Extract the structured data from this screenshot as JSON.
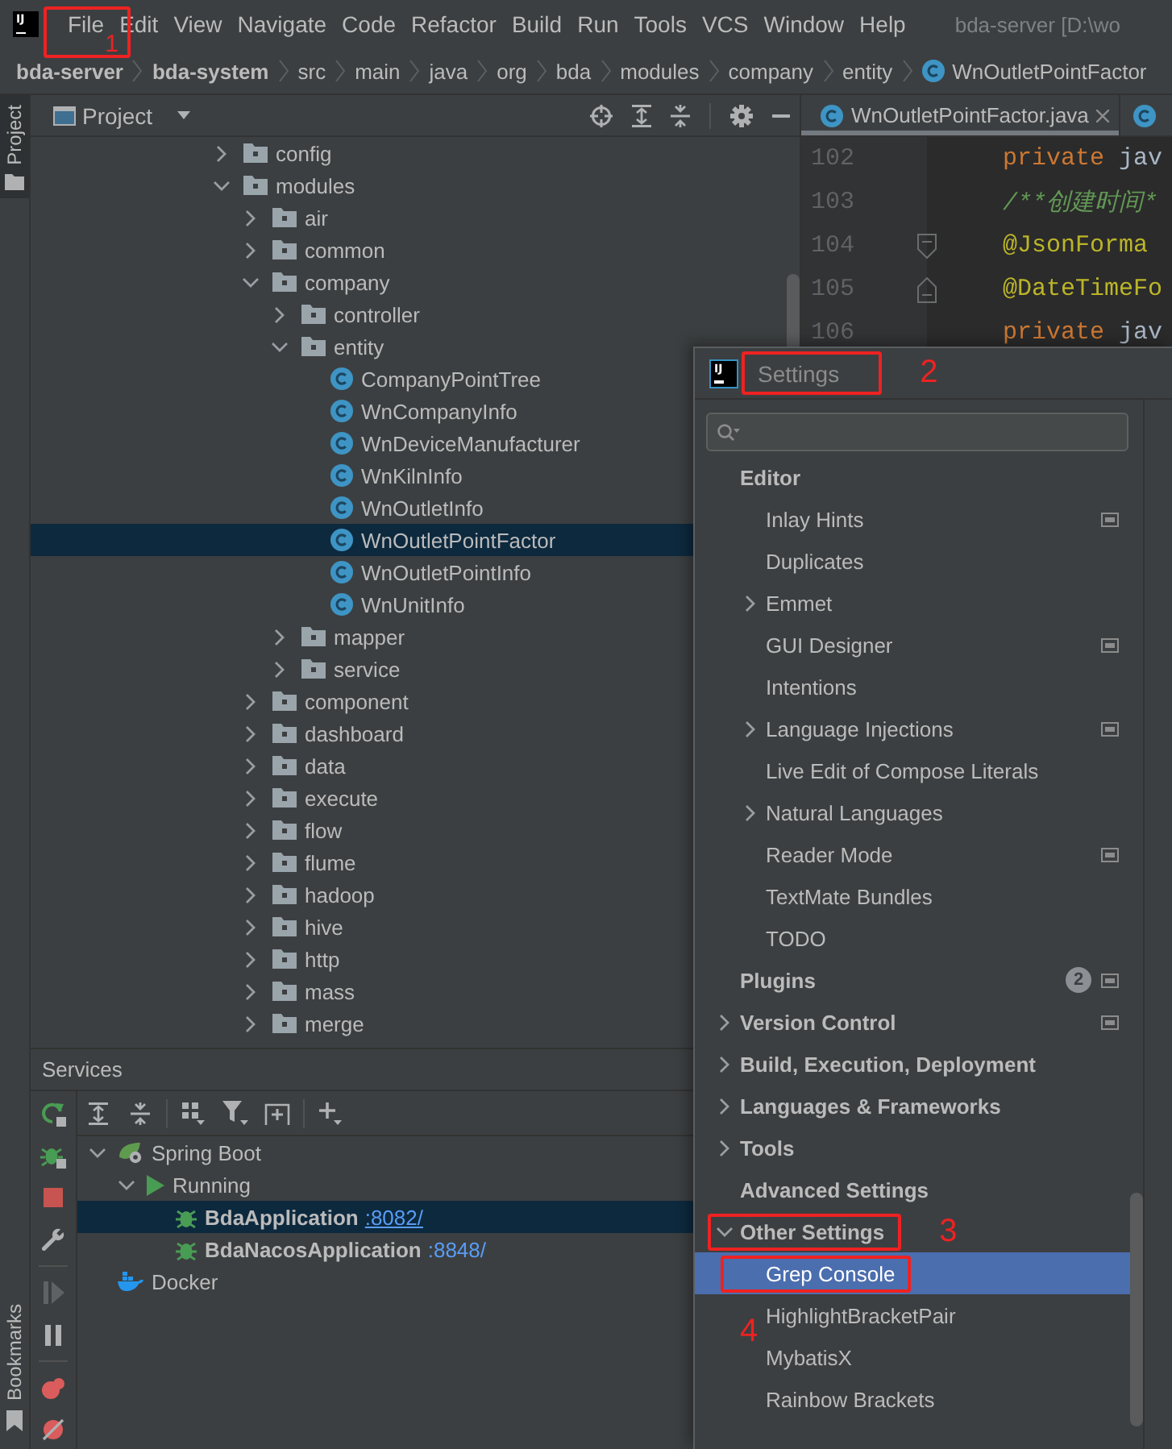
{
  "menu_bar": {
    "logo": "IJ",
    "items": [
      {
        "label": "File",
        "annotation": {
          "number": "1",
          "kind": "inside"
        }
      },
      {
        "label": "Edit"
      },
      {
        "label": "View"
      },
      {
        "label": "Navigate"
      },
      {
        "label": "Code"
      },
      {
        "label": "Refactor"
      },
      {
        "label": "Build"
      },
      {
        "label": "Run"
      },
      {
        "label": "Tools"
      },
      {
        "label": "VCS"
      },
      {
        "label": "Window"
      },
      {
        "label": "Help"
      }
    ],
    "window_title": "bda-server [D:\\wo"
  },
  "breadcrumb": [
    {
      "label": "bda-server",
      "kind": "module"
    },
    {
      "label": "bda-system",
      "kind": "module"
    },
    {
      "label": "src",
      "kind": "folder"
    },
    {
      "label": "main",
      "kind": "folder"
    },
    {
      "label": "java",
      "kind": "folder"
    },
    {
      "label": "org",
      "kind": "folder"
    },
    {
      "label": "bda",
      "kind": "folder"
    },
    {
      "label": "modules",
      "kind": "folder"
    },
    {
      "label": "company",
      "kind": "folder"
    },
    {
      "label": "entity",
      "kind": "folder"
    },
    {
      "label": "WnOutletPointFactor",
      "kind": "class"
    }
  ],
  "tool_stripe": {
    "top": [
      {
        "label": "Project",
        "selected": true
      }
    ],
    "bottom": [
      {
        "label": "Bookmarks",
        "selected": false
      }
    ]
  },
  "project_panel": {
    "title": "Project",
    "tree": [
      {
        "label": "config",
        "kind": "folder",
        "expanded": false,
        "selected": false
      },
      {
        "label": "modules",
        "kind": "folder",
        "expanded": true,
        "selected": false,
        "children": [
          {
            "label": "air",
            "kind": "folder",
            "expanded": false,
            "selected": false
          },
          {
            "label": "common",
            "kind": "folder",
            "expanded": false,
            "selected": false
          },
          {
            "label": "company",
            "kind": "folder",
            "expanded": true,
            "selected": false,
            "children": [
              {
                "label": "controller",
                "kind": "folder",
                "expanded": false,
                "selected": false
              },
              {
                "label": "entity",
                "kind": "folder",
                "expanded": true,
                "selected": false,
                "children": [
                  {
                    "label": "CompanyPointTree",
                    "kind": "class",
                    "selected": false
                  },
                  {
                    "label": "WnCompanyInfo",
                    "kind": "class",
                    "selected": false
                  },
                  {
                    "label": "WnDeviceManufacturer",
                    "kind": "class",
                    "selected": false
                  },
                  {
                    "label": "WnKilnInfo",
                    "kind": "class",
                    "selected": false
                  },
                  {
                    "label": "WnOutletInfo",
                    "kind": "class",
                    "selected": false
                  },
                  {
                    "label": "WnOutletPointFactor",
                    "kind": "class",
                    "selected": true
                  },
                  {
                    "label": "WnOutletPointInfo",
                    "kind": "class",
                    "selected": false
                  },
                  {
                    "label": "WnUnitInfo",
                    "kind": "class",
                    "selected": false
                  }
                ]
              },
              {
                "label": "mapper",
                "kind": "folder",
                "expanded": false,
                "selected": false
              },
              {
                "label": "service",
                "kind": "folder",
                "expanded": false,
                "selected": false
              }
            ]
          },
          {
            "label": "component",
            "kind": "folder",
            "expanded": false,
            "selected": false
          },
          {
            "label": "dashboard",
            "kind": "folder",
            "expanded": false,
            "selected": false
          },
          {
            "label": "data",
            "kind": "folder",
            "expanded": false,
            "selected": false
          },
          {
            "label": "execute",
            "kind": "folder",
            "expanded": false,
            "selected": false
          },
          {
            "label": "flow",
            "kind": "folder",
            "expanded": false,
            "selected": false
          },
          {
            "label": "flume",
            "kind": "folder",
            "expanded": false,
            "selected": false
          },
          {
            "label": "hadoop",
            "kind": "folder",
            "expanded": false,
            "selected": false
          },
          {
            "label": "hive",
            "kind": "folder",
            "expanded": false,
            "selected": false
          },
          {
            "label": "http",
            "kind": "folder",
            "expanded": false,
            "selected": false
          },
          {
            "label": "mass",
            "kind": "folder",
            "expanded": false,
            "selected": false
          },
          {
            "label": "merge",
            "kind": "folder",
            "expanded": false,
            "selected": false
          }
        ]
      }
    ]
  },
  "editor": {
    "tabs": [
      {
        "label": "WnOutletPointFactor.java",
        "selected": true
      },
      {
        "selected": false
      }
    ],
    "code": [
      {
        "number": "102",
        "kind": "plain",
        "tokens": [
          {
            "kind": "keyword",
            "text": "private"
          },
          {
            "kind": "plain",
            "text": " jav"
          }
        ]
      },
      {
        "number": "103",
        "kind": "plain",
        "tokens": [
          {
            "kind": "comment",
            "text": "/**创建时间*"
          }
        ]
      },
      {
        "number": "104",
        "kind": "fold_start",
        "tokens": [
          {
            "kind": "annotation",
            "text": "@JsonForma"
          }
        ]
      },
      {
        "number": "105",
        "kind": "fold_end",
        "tokens": [
          {
            "kind": "annotation",
            "text": "@DateTimeFo"
          }
        ]
      },
      {
        "number": "106",
        "kind": "plain",
        "tokens": [
          {
            "kind": "keyword",
            "text": "private"
          },
          {
            "kind": "plain",
            "text": " jav"
          }
        ]
      }
    ]
  },
  "services": {
    "title": "Services",
    "tree": [
      {
        "label": "Spring Boot",
        "kind": "spring",
        "expanded": true,
        "selected": false,
        "children": [
          {
            "label": "Running",
            "kind": "status",
            "expanded": true,
            "selected": false,
            "children": [
              {
                "label": "BdaApplication",
                "kind": "app",
                "port": ":8082/",
                "selected": true
              },
              {
                "label": "BdaNacosApplication",
                "kind": "app",
                "port": ":8848/",
                "selected": false
              }
            ]
          }
        ]
      },
      {
        "label": "Docker",
        "kind": "docker",
        "selected": false
      }
    ]
  },
  "settings_dialog": {
    "logo": "IJ",
    "title": {
      "text": "Settings",
      "annotation": {
        "number": "2",
        "kind": "right"
      }
    },
    "items": [
      {
        "label": "Editor",
        "selected": false,
        "per_project": false,
        "children": [
          {
            "label": "Inlay Hints",
            "selected": false,
            "per_project": true
          },
          {
            "label": "Duplicates",
            "selected": false,
            "per_project": false
          },
          {
            "label": "Emmet",
            "expanded": false,
            "selected": false,
            "per_project": false
          },
          {
            "label": "GUI Designer",
            "selected": false,
            "per_project": true
          },
          {
            "label": "Intentions",
            "selected": false,
            "per_project": false
          },
          {
            "label": "Language Injections",
            "expanded": false,
            "selected": false,
            "per_project": true
          },
          {
            "label": "Live Edit of Compose Literals",
            "selected": false,
            "per_project": false
          },
          {
            "label": "Natural Languages",
            "expanded": false,
            "selected": false,
            "per_project": false
          },
          {
            "label": "Reader Mode",
            "selected": false,
            "per_project": true
          },
          {
            "label": "TextMate Bundles",
            "selected": false,
            "per_project": false
          },
          {
            "label": "TODO",
            "selected": false,
            "per_project": false
          }
        ]
      },
      {
        "label": "Plugins",
        "badge": "2",
        "selected": false,
        "per_project": true
      },
      {
        "label": "Version Control",
        "expanded": false,
        "selected": false,
        "per_project": true
      },
      {
        "label": "Build, Execution, Deployment",
        "expanded": false,
        "selected": false,
        "per_project": false
      },
      {
        "label": "Languages & Frameworks",
        "expanded": false,
        "selected": false,
        "per_project": false
      },
      {
        "label": "Tools",
        "expanded": false,
        "selected": false,
        "per_project": false
      },
      {
        "label": "Advanced Settings",
        "selected": false,
        "per_project": false
      },
      {
        "label": "Other Settings",
        "expanded": true,
        "selected": false,
        "per_project": false,
        "annotation": {
          "number": "3",
          "kind": "right"
        },
        "children": [
          {
            "label": "Grep Console",
            "selected": true,
            "per_project": false,
            "annotation": {
              "number": "4",
              "kind": "below"
            }
          },
          {
            "label": "HighlightBracketPair",
            "selected": false,
            "per_project": false
          },
          {
            "label": "MybatisX",
            "selected": false,
            "per_project": false
          },
          {
            "label": "Rainbow Brackets",
            "selected": false,
            "per_project": false
          }
        ]
      }
    ]
  }
}
